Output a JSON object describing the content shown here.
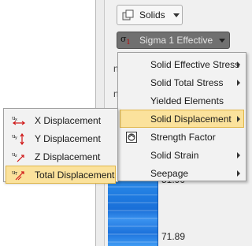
{
  "toolbar": {
    "solids_label": "Solids",
    "result_type_label": "Sigma 1 Effective"
  },
  "background": {
    "partial_text_1": "n",
    "partial_text_2": "n",
    "contour_value_top": "51.90",
    "contour_value_bottom": "71.89"
  },
  "menu": {
    "items": [
      {
        "label": "Solid Effective Stress",
        "has_submenu": true,
        "icon": ""
      },
      {
        "label": "Solid Total Stress",
        "has_submenu": true,
        "icon": ""
      },
      {
        "label": "Yielded Elements",
        "has_submenu": false,
        "icon": ""
      },
      {
        "label": "Solid Displacement",
        "has_submenu": true,
        "icon": "",
        "highlighted": true
      },
      {
        "label": "Strength Factor",
        "has_submenu": false,
        "icon": "strength-factor-icon"
      },
      {
        "label": "Solid Strain",
        "has_submenu": true,
        "icon": ""
      },
      {
        "label": "Seepage",
        "has_submenu": true,
        "icon": ""
      }
    ]
  },
  "submenu": {
    "items": [
      {
        "label": "X Displacement",
        "icon": "x-displacement-icon"
      },
      {
        "label": "Y Displacement",
        "icon": "y-displacement-icon"
      },
      {
        "label": "Z Displacement",
        "icon": "z-displacement-icon"
      },
      {
        "label": "Total Displacement",
        "icon": "total-displacement-icon",
        "highlighted": true
      }
    ]
  },
  "colors": {
    "highlight_bg": "#fbe29c",
    "highlight_border": "#e0b64a",
    "sigma_button_bg": "#707070",
    "contour_blue": "#1e7ae0"
  }
}
